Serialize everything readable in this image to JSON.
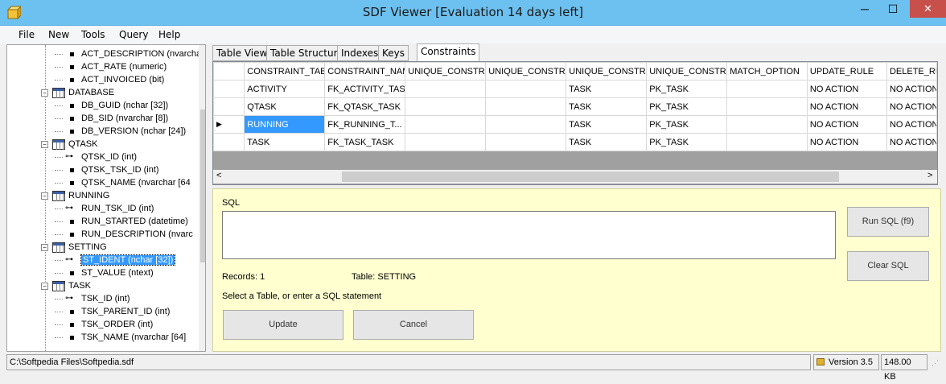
{
  "window": {
    "title": "SDF Viewer [Evaluation 14 days left]",
    "minimize": "─",
    "maximize": "☐",
    "close": "✕"
  },
  "menu": [
    "File",
    "New",
    "Tools",
    "Query",
    "Help"
  ],
  "tree": [
    {
      "kind": "col",
      "label": "ACT_DESCRIPTION (nvarchar"
    },
    {
      "kind": "col",
      "label": "ACT_RATE (numeric)"
    },
    {
      "kind": "col",
      "label": "ACT_INVOICED (bit)"
    },
    {
      "kind": "table",
      "label": "DATABASE"
    },
    {
      "kind": "col",
      "label": "DB_GUID (nchar [32])"
    },
    {
      "kind": "col",
      "label": "DB_SID (nvarchar [8])"
    },
    {
      "kind": "col",
      "label": "DB_VERSION (nchar [24])"
    },
    {
      "kind": "table",
      "label": "QTASK"
    },
    {
      "kind": "key",
      "label": "QTSK_ID (int)"
    },
    {
      "kind": "col",
      "label": "QTSK_TSK_ID (int)"
    },
    {
      "kind": "col",
      "label": "QTSK_NAME (nvarchar [64"
    },
    {
      "kind": "table",
      "label": "RUNNING"
    },
    {
      "kind": "key",
      "label": "RUN_TSK_ID (int)"
    },
    {
      "kind": "col",
      "label": "RUN_STARTED (datetime)"
    },
    {
      "kind": "col",
      "label": "RUN_DESCRIPTION (nvarc"
    },
    {
      "kind": "table",
      "label": "SETTING"
    },
    {
      "kind": "key",
      "label": "ST_IDENT (nchar [32])",
      "selected": true
    },
    {
      "kind": "col",
      "label": "ST_VALUE (ntext)"
    },
    {
      "kind": "table",
      "label": "TASK"
    },
    {
      "kind": "key",
      "label": "TSK_ID (int)"
    },
    {
      "kind": "col",
      "label": "TSK_PARENT_ID (int)"
    },
    {
      "kind": "col",
      "label": "TSK_ORDER (int)"
    },
    {
      "kind": "col",
      "label": "TSK_NAME (nvarchar [64]"
    }
  ],
  "tabs": [
    "Table View",
    "Table Structure",
    "Indexes",
    "Keys",
    "Constraints"
  ],
  "active_tab": "Constraints",
  "grid": {
    "columns": [
      "CONSTRAINT_TABL",
      "CONSTRAINT_NAM",
      "UNIQUE_CONSTRA",
      "UNIQUE_CONSTRA",
      "UNIQUE_CONSTRA",
      "UNIQUE_CONSTRA",
      "MATCH_OPTION",
      "UPDATE_RULE",
      "DELETE_RU"
    ],
    "rows": [
      [
        "ACTIVITY",
        "FK_ACTIVITY_TASK",
        "",
        "",
        "TASK",
        "PK_TASK",
        "",
        "NO ACTION",
        "NO ACTION"
      ],
      [
        "QTASK",
        "FK_QTASK_TASK",
        "",
        "",
        "TASK",
        "PK_TASK",
        "",
        "NO ACTION",
        "NO ACTION"
      ],
      [
        "RUNNING",
        "FK_RUNNING_T...",
        "",
        "",
        "TASK",
        "PK_TASK",
        "",
        "NO ACTION",
        "NO ACTION"
      ],
      [
        "TASK",
        "FK_TASK_TASK",
        "",
        "",
        "TASK",
        "PK_TASK",
        "",
        "NO ACTION",
        "NO ACTION"
      ]
    ],
    "current_row_marker": "▶"
  },
  "sql": {
    "label": "SQL",
    "value": "",
    "records": "Records: 1",
    "table": "Table: SETTING",
    "hint": "Select a Table, or enter a SQL statement",
    "run_button": "Run SQL (f9)",
    "clear_button": "Clear SQL",
    "update_button": "Update",
    "cancel_button": "Cancel"
  },
  "status": {
    "path": "C:\\Softpedia Files\\Softpedia.sdf",
    "version": "Version 3.5",
    "size": "148.00 KB"
  },
  "colors": {
    "titlebar": "#6dc1f0",
    "selection": "#3399ff",
    "sql_panel": "#ffffd0",
    "close_button": "#c7504a"
  }
}
